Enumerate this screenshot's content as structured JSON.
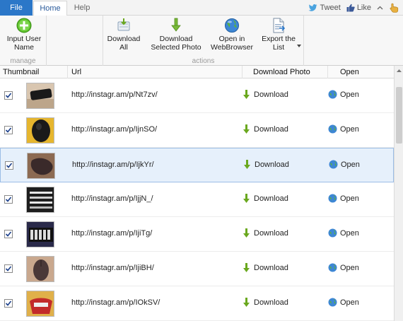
{
  "tabs": {
    "file": "File",
    "home": "Home",
    "help": "Help"
  },
  "top_right": {
    "tweet": "Tweet",
    "like": "Like"
  },
  "ribbon": {
    "manage": {
      "label": "manage",
      "input_user_name": "Input User Name"
    },
    "actions": {
      "label": "actions",
      "download_all": "Download All",
      "download_selected": "Download Selected Photo",
      "open_in_browser": "Open in WebBrowser",
      "export_list": "Export the List"
    }
  },
  "columns": {
    "thumbnail": "Thumbnail",
    "url": "Url",
    "download_photo": "Download Photo",
    "open": "Open"
  },
  "rows": [
    {
      "url": "http://instagr.am/p/Nt7zv/",
      "download": "Download",
      "open": "Open",
      "checked": true,
      "selected": false
    },
    {
      "url": "http://instagr.am/p/IjnSO/",
      "download": "Download",
      "open": "Open",
      "checked": true,
      "selected": false
    },
    {
      "url": "http://instagr.am/p/IjkYr/",
      "download": "Download",
      "open": "Open",
      "checked": true,
      "selected": true
    },
    {
      "url": "http://instagr.am/p/IjjN_/",
      "download": "Download",
      "open": "Open",
      "checked": true,
      "selected": false
    },
    {
      "url": "http://instagr.am/p/IjiTg/",
      "download": "Download",
      "open": "Open",
      "checked": true,
      "selected": false
    },
    {
      "url": "http://instagr.am/p/IjiBH/",
      "download": "Download",
      "open": "Open",
      "checked": true,
      "selected": false
    },
    {
      "url": "http://instagr.am/p/IOkSV/",
      "download": "Download",
      "open": "Open",
      "checked": true,
      "selected": false
    }
  ],
  "colors": {
    "accent": "#2b77c8",
    "selected_row": "#e6f0fb",
    "download_arrow": "#6aa81e"
  }
}
